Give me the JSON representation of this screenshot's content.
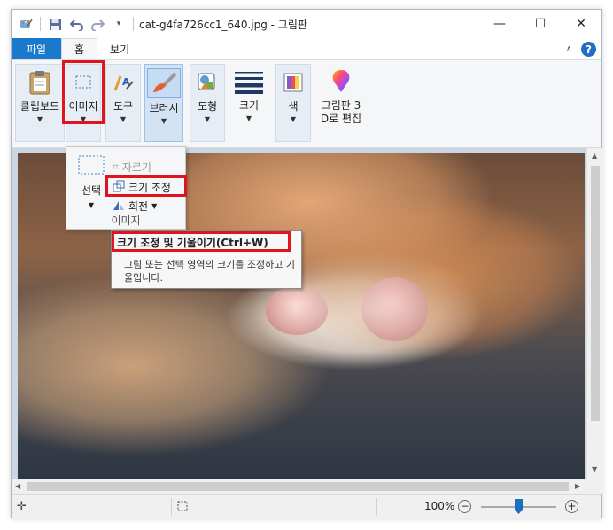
{
  "window": {
    "title": "cat-g4fa726cc1_640.jpg - 그림판",
    "controls": {
      "minimize": "—",
      "maximize": "☐",
      "close": "✕"
    }
  },
  "tabs": {
    "file": "파일",
    "home": "홈",
    "view": "보기"
  },
  "ribbon": {
    "clipboard": "클립보드",
    "image": "이미지",
    "tools": "도구",
    "brushes": "브러시",
    "shapes": "도형",
    "size": "크기",
    "color": "색",
    "paint3d_line1": "그림판 3",
    "paint3d_line2": "D로 편집"
  },
  "image_dropdown": {
    "select": "선택",
    "crop": "자르기",
    "resize": "크기 조정",
    "rotate": "회전",
    "group_label": "이미지"
  },
  "tooltip": {
    "title": "크기 조정 및 기울이기(Ctrl+W)",
    "body": "그림 또는 선택 영역의 크기를 조정하고 기울입니다."
  },
  "statusbar": {
    "zoom": "100%"
  },
  "colors": {
    "accent": "#1979ca",
    "highlight_box": "#e0141e",
    "zoom_thumb": "#1a6fc0"
  }
}
